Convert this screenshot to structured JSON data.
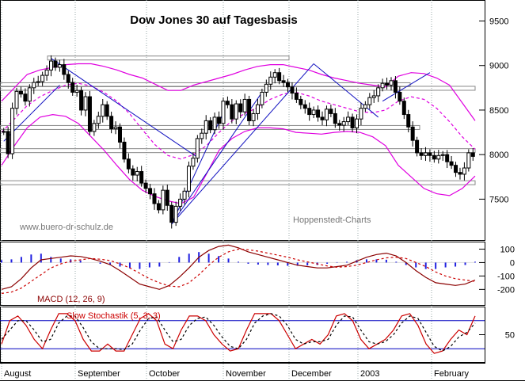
{
  "chart_data": {
    "type": "candlestick",
    "title": "Dow Jones 30 auf Tagesbasis",
    "watermark": "www.buero-dr-schulz.de",
    "source": "Hoppenstedt-Charts",
    "price_axis": {
      "ticks": [
        7500,
        8000,
        8500,
        9000,
        9500
      ],
      "range": [
        7050,
        9700
      ]
    },
    "months": [
      "August",
      "September",
      "October",
      "November",
      "December",
      "2003",
      "February"
    ],
    "price": {
      "candles_description": "daily OHLC, approx. Jul 25 2002 - Feb 19 2003",
      "closes": [
        8260,
        8010,
        8520,
        8710,
        8680,
        8600,
        8750,
        8810,
        8820,
        8890,
        8950,
        9050,
        8980,
        9010,
        8900,
        8810,
        8700,
        8720,
        8500,
        8650,
        8260,
        8350,
        8430,
        8560,
        8430,
        8290,
        8310,
        8140,
        7950,
        7840,
        7770,
        7810,
        7680,
        7620,
        7560,
        7450,
        7380,
        7600,
        7430,
        7240,
        7420,
        7500,
        7590,
        7870,
        7960,
        8180,
        8240,
        8380,
        8280,
        8420,
        8350,
        8600,
        8560,
        8400,
        8570,
        8480,
        8620,
        8380,
        8460,
        8560,
        8700,
        8790,
        8870,
        8920,
        8830,
        8810,
        8760,
        8690,
        8620,
        8560,
        8520,
        8450,
        8500,
        8420,
        8390,
        8510,
        8460,
        8350,
        8330,
        8370,
        8420,
        8300,
        8400,
        8520,
        8560,
        8640,
        8660,
        8750,
        8800,
        8780,
        8830,
        8700,
        8600,
        8450,
        8310,
        8160,
        8020,
        7990,
        8020,
        7990,
        7950,
        7990,
        8000,
        7920,
        7880,
        7800,
        7780,
        7850,
        8020,
        7980
      ],
      "bollinger_upper": [
        8600,
        8750,
        8900,
        8950,
        8980,
        9010,
        9020,
        9020,
        8990,
        8950,
        8900,
        8860,
        8790,
        8720,
        8720,
        8780,
        8820,
        8860,
        8900,
        8950,
        8990,
        9010,
        9010,
        8980,
        8950,
        8900,
        8860,
        8830,
        8800,
        8780,
        8760,
        8880,
        8920,
        8910,
        8860,
        8780,
        8580,
        8380
      ],
      "bollinger_lower": [
        7880,
        8100,
        8300,
        8420,
        8450,
        8430,
        8350,
        8200,
        8050,
        7880,
        7720,
        7600,
        7530,
        7480,
        7450,
        7520,
        7780,
        8050,
        8180,
        8260,
        8300,
        8300,
        8290,
        8250,
        8240,
        8230,
        8250,
        8260,
        8250,
        8200,
        8100,
        7880,
        7750,
        7620,
        7560,
        7540,
        7620,
        7760
      ],
      "moving_average": [
        8250,
        8400,
        8550,
        8650,
        8720,
        8780,
        8800,
        8770,
        8700,
        8600,
        8460,
        8280,
        8110,
        7990,
        7950,
        8000,
        8100,
        8250,
        8380,
        8460,
        8530,
        8620,
        8680,
        8700,
        8660,
        8600,
        8560,
        8520,
        8480,
        8470,
        8500,
        8600,
        8650,
        8620,
        8520,
        8370,
        8200,
        8060
      ],
      "support_resistance_levels": [
        9080,
        8780,
        8740,
        8300,
        8040,
        7680
      ],
      "trend_lines": [
        {
          "from_day": 0,
          "from": 8150,
          "to_day": 13,
          "to": 8780
        },
        {
          "from_day": 11,
          "from": 9080,
          "to_day": 45,
          "to": 7970
        },
        {
          "from_day": 39,
          "from": 7220,
          "to_day": 51,
          "to": 8470
        },
        {
          "from_day": 39,
          "from": 7220,
          "to_day": 60,
          "to": 8700
        },
        {
          "from_day": 39,
          "from": 7220,
          "to_day": 72,
          "to": 9020
        },
        {
          "from_day": 72,
          "from": 9020,
          "to_day": 87,
          "to": 8420
        },
        {
          "from_day": 88,
          "from": 8600,
          "to_day": 99,
          "to": 8920
        }
      ]
    },
    "macd": {
      "label": "MACD (12, 26, 9)",
      "axis_ticks": [
        100,
        0,
        -100,
        -200
      ],
      "range": [
        -310,
        150
      ],
      "macd_line": [
        -200,
        -180,
        -120,
        -40,
        20,
        30,
        40,
        50,
        45,
        30,
        10,
        -15,
        -60,
        -110,
        -160,
        -180,
        -200,
        -170,
        -110,
        -40,
        40,
        90,
        120,
        130,
        110,
        80,
        60,
        40,
        20,
        0,
        -20,
        -30,
        -40,
        -40,
        -30,
        -20,
        10,
        40,
        60,
        70,
        50,
        0,
        -60,
        -110,
        -150,
        -160,
        -170,
        -160,
        -130
      ],
      "signal_line": [
        -230,
        -220,
        -190,
        -140,
        -90,
        -40,
        -10,
        10,
        20,
        30,
        25,
        15,
        -10,
        -40,
        -80,
        -120,
        -150,
        -175,
        -180,
        -150,
        -90,
        -20,
        40,
        80,
        100,
        95,
        85,
        70,
        55,
        40,
        20,
        5,
        -10,
        -25,
        -35,
        -30,
        -20,
        0,
        20,
        35,
        40,
        30,
        0,
        -30,
        -70,
        -100,
        -120,
        -130,
        -140
      ],
      "histogram_note": "blue vertical histogram bars around zero line"
    },
    "stochastic": {
      "label": "Slow Stochastik (5, 3, 3)",
      "axis_ticks": [
        50
      ],
      "reference_levels": [
        80,
        20
      ],
      "k_line": [
        30,
        80,
        90,
        70,
        40,
        20,
        60,
        95,
        95,
        80,
        40,
        15,
        15,
        30,
        15,
        15,
        50,
        85,
        95,
        80,
        30,
        20,
        60,
        90,
        90,
        80,
        50,
        30,
        15,
        20,
        60,
        95,
        95,
        95,
        80,
        50,
        20,
        30,
        40,
        30,
        50,
        90,
        95,
        80,
        40,
        20,
        30,
        40,
        60,
        90,
        95,
        70,
        30,
        10,
        15,
        40,
        60,
        50,
        90
      ],
      "d_line": [
        40,
        60,
        80,
        80,
        60,
        35,
        40,
        75,
        90,
        90,
        65,
        35,
        20,
        20,
        20,
        18,
        30,
        60,
        85,
        88,
        60,
        35,
        40,
        70,
        85,
        88,
        70,
        45,
        25,
        20,
        40,
        75,
        90,
        95,
        90,
        70,
        40,
        30,
        35,
        35,
        40,
        70,
        90,
        88,
        60,
        35,
        30,
        35,
        50,
        75,
        90,
        85,
        55,
        25,
        15,
        25,
        45,
        55,
        75
      ]
    }
  }
}
